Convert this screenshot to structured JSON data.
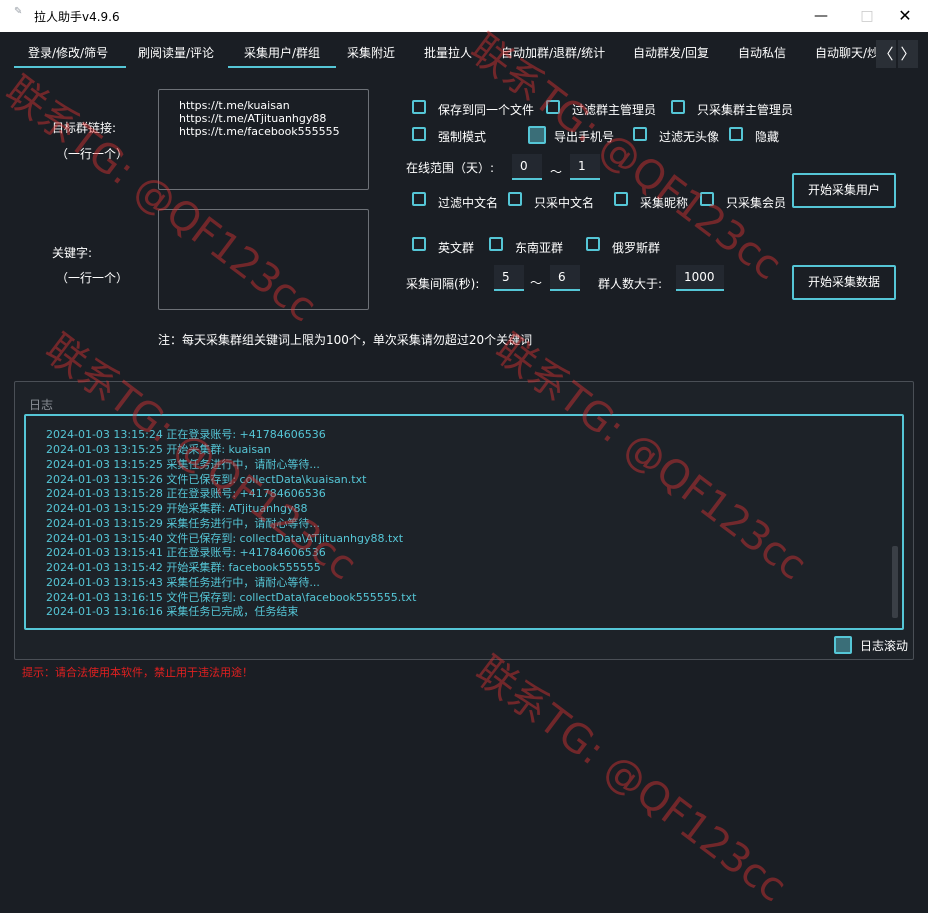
{
  "window": {
    "title": "拉人助手v4.9.6",
    "minimize_symbol": "—",
    "maximize_symbol": "□",
    "close_symbol": "✕",
    "app_icon": "✎"
  },
  "tabs": [
    {
      "label": "登录/修改/筛号"
    },
    {
      "label": "刷阅读量/评论"
    },
    {
      "label": "采集用户/群组"
    },
    {
      "label": "采集附近"
    },
    {
      "label": "批量拉人"
    },
    {
      "label": "自动加群/退群/统计"
    },
    {
      "label": "自动群发/回复"
    },
    {
      "label": "自动私信"
    },
    {
      "label": "自动聊天/炒"
    }
  ],
  "tab_nav": {
    "prev": "〈",
    "next": "〉"
  },
  "form": {
    "target_group_label": "目标群链接:",
    "target_group_hint": "（一行一个）",
    "target_links": "https://t.me/kuaisan\nhttps://t.me/ATjituanhgy88\nhttps://t.me/facebook555555",
    "keyword_label": "关键字:",
    "keyword_hint": "（一行一个）",
    "keywords": "",
    "note": "注：每天采集群组关键词上限为100个，单次采集请勿超过20个关键词"
  },
  "options": {
    "save_same_file": "保存到同一个文件",
    "filter_admins": "过滤群主管理员",
    "only_admins": "只采集群主管理员",
    "force_mode": "强制模式",
    "export_phone": "导出手机号",
    "filter_no_avatar": "过滤无头像",
    "hide": "隐藏",
    "online_range_label": "在线范围（天）:",
    "online_from": "0",
    "online_to": "1",
    "range_sep": "～",
    "filter_chinese": "过滤中文名",
    "only_chinese": "只采中文名",
    "collect_nickname": "采集昵称",
    "only_members": "只采集会员",
    "english_group": "英文群",
    "sea_group": "东南亚群",
    "russia_group": "俄罗斯群",
    "interval_label": "采集间隔(秒):",
    "interval_from": "5",
    "interval_to": "6",
    "min_members_label": "群人数大于:",
    "min_members": "1000"
  },
  "buttons": {
    "start_users": "开始采集用户",
    "start_data": "开始采集数据"
  },
  "log": {
    "title": "日志",
    "lines": [
      "2024-01-03 13:15:24 正在登录账号: +41784606536",
      "2024-01-03 13:15:25 开始采集群: kuaisan",
      "2024-01-03 13:15:25 采集任务进行中，请耐心等待...",
      "2024-01-03 13:15:26 文件已保存到: collectData\\kuaisan.txt",
      "2024-01-03 13:15:28 正在登录账号: +41784606536",
      "2024-01-03 13:15:29 开始采集群: ATjituanhgy88",
      "2024-01-03 13:15:29 采集任务进行中，请耐心等待...",
      "2024-01-03 13:15:40 文件已保存到: collectData\\ATjituanhgy88.txt",
      "2024-01-03 13:15:41 正在登录账号: +41784606536",
      "2024-01-03 13:15:42 开始采集群: facebook555555",
      "2024-01-03 13:15:43 采集任务进行中，请耐心等待...",
      "2024-01-03 13:16:15 文件已保存到: collectData\\facebook555555.txt",
      "2024-01-03 13:16:16 采集任务已完成，任务结束"
    ],
    "autoscroll_label": "日志滚动"
  },
  "footer_warning": "提示：请合法使用本软件，禁止用于违法用途！",
  "watermark": "联系TG: @QF123cc",
  "colors": {
    "accent": "#55c6d6",
    "background": "#1a1e24",
    "warning": "#e02020"
  }
}
